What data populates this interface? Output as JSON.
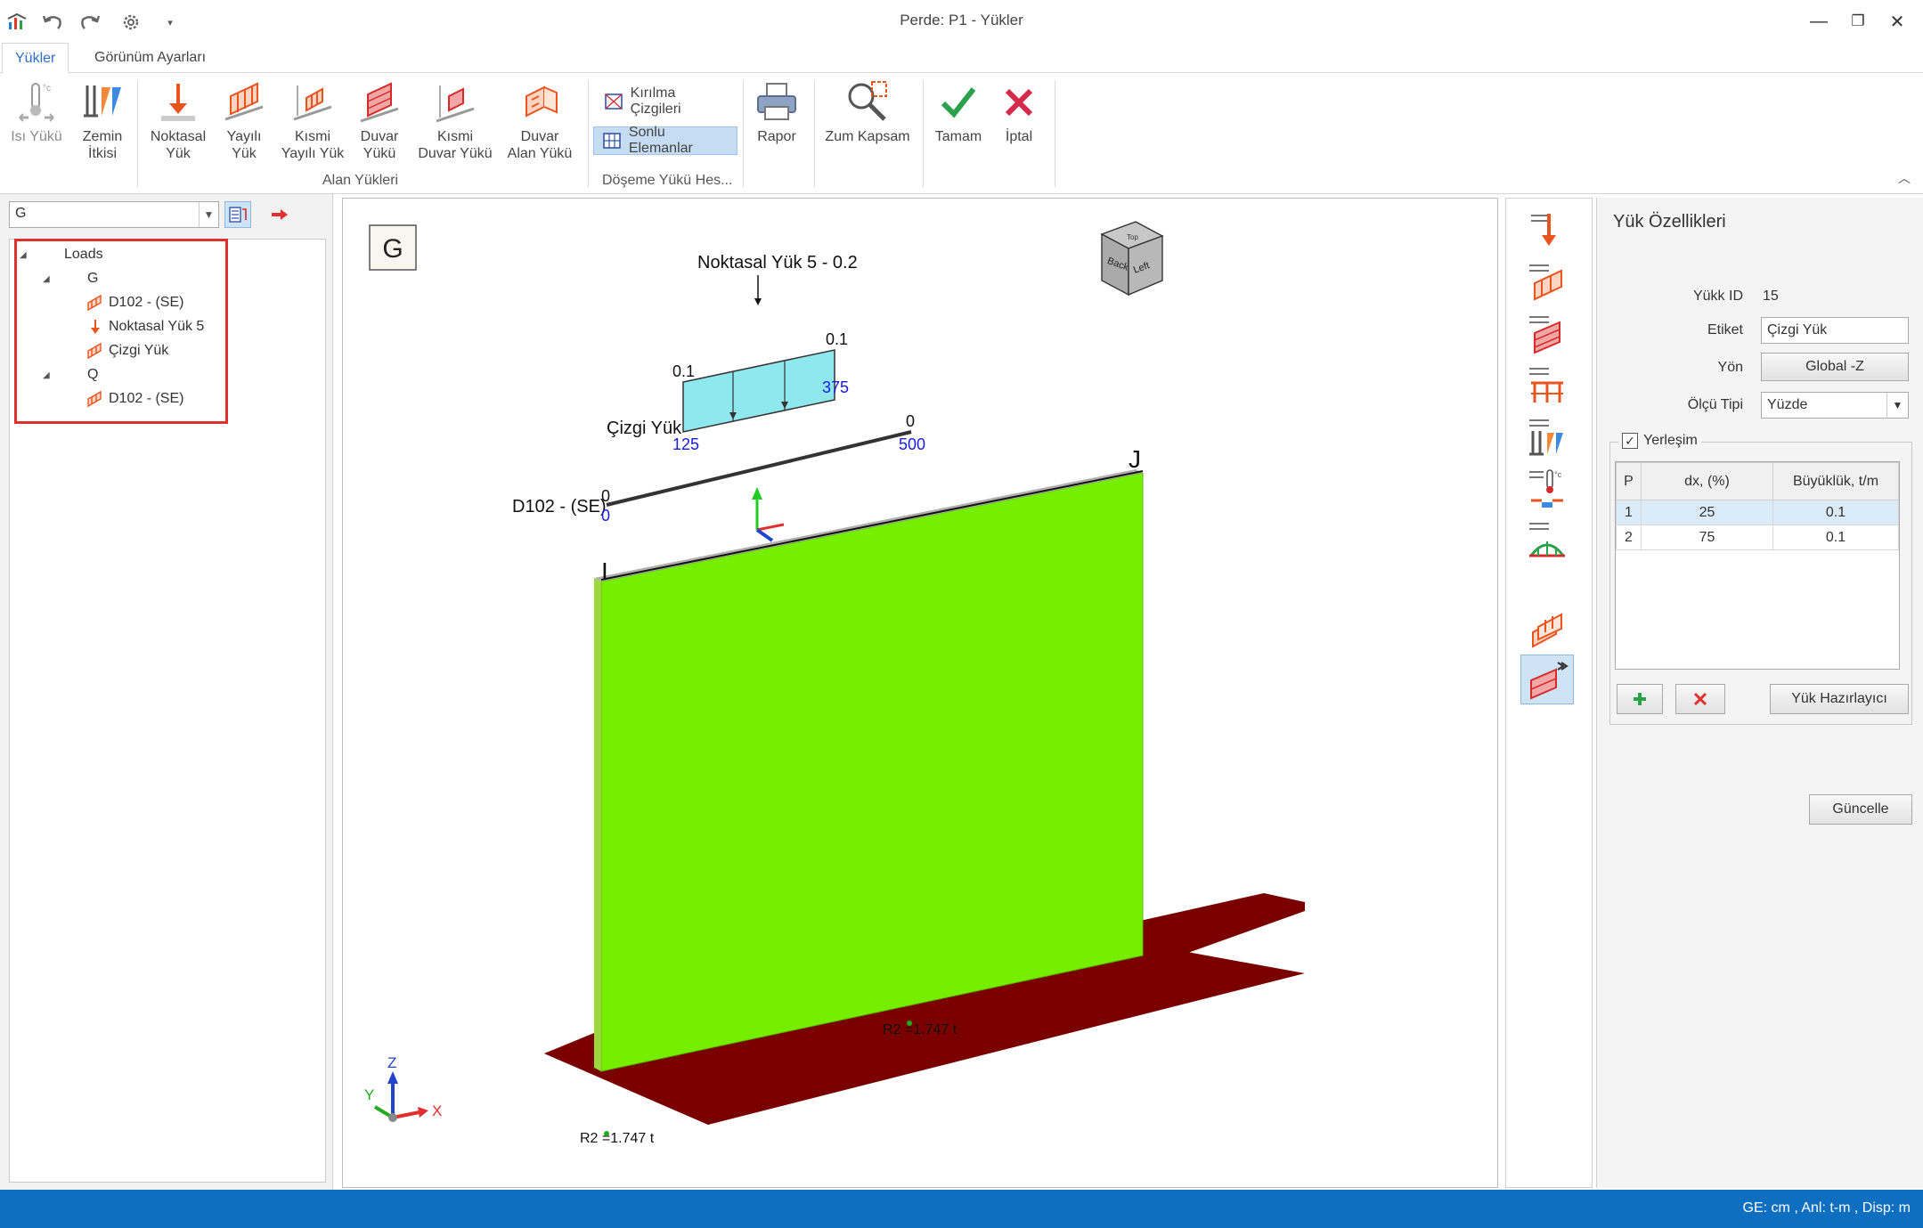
{
  "window": {
    "title": "Perde: P1 - Yükler"
  },
  "tabs": [
    {
      "label": "Yükler",
      "active": true
    },
    {
      "label": "Görünüm Ayarları",
      "active": false
    }
  ],
  "ribbon": {
    "isi_yuku": "Isı Yükü",
    "zemin": [
      "Zemin",
      "İtkisi"
    ],
    "noktasal": [
      "Noktasal",
      "Yük"
    ],
    "yayili": [
      "Yayılı",
      "Yük"
    ],
    "kismi_yayili": [
      "Kısmi",
      "Yayılı Yük"
    ],
    "duvar": [
      "Duvar",
      "Yükü"
    ],
    "kismi_duvar": [
      "Kısmi",
      "Duvar Yükü"
    ],
    "duvar_alan": [
      "Duvar",
      "Alan Yükü"
    ],
    "group_alan": "Alan Yükleri",
    "kirilma": "Kırılma Çizgileri",
    "sonlu": "Sonlu Elemanlar",
    "group_doseme": "Döşeme Yükü Hes...",
    "rapor": "Rapor",
    "zum": "Zum Kapsam",
    "tamam": "Tamam",
    "iptal": "İptal"
  },
  "left": {
    "combo_value": "G",
    "tree": {
      "root": "Loads",
      "g": "G",
      "g_items": [
        "D102 - (SE)",
        "Noktasal Yük 5",
        "Çizgi Yük"
      ],
      "q": "Q",
      "q_items": [
        "D102 - (SE)"
      ]
    }
  },
  "viewport": {
    "case_label": "G",
    "point_load_label": "Noktasal Yük 5 - 0.2",
    "line_load_label": "Çizgi Yük",
    "member_label": "D102 - (SE)",
    "val_left_top": "0.1",
    "val_right_top": "0.1",
    "pos_125": "125",
    "pos_375": "375",
    "pos_500": "500",
    "zero_a": "0",
    "zero_b": "0",
    "zero_c": "0",
    "node_i": "I",
    "node_j": "J",
    "reaction_left": "R2 =1.747 t",
    "reaction_right": "R2 =1.747 t",
    "axis_z": "Z",
    "axis_y": "Y",
    "axis_x": "X",
    "cube_back": "Back",
    "cube_left": "Left",
    "cube_top": "Top"
  },
  "props": {
    "title": "Yük Özellikleri",
    "id_label": "Yükk ID",
    "id_value": "15",
    "etiket_label": "Etiket",
    "etiket_value": "Çizgi Yük",
    "yon_label": "Yön",
    "yon_value": "Global -Z",
    "olcu_label": "Ölçü Tipi",
    "olcu_value": "Yüzde",
    "yerlesim_label": "Yerleşim",
    "grid_headers": [
      "P",
      "dx, (%)",
      "Büyüklük, t/m"
    ],
    "grid_rows": [
      {
        "p": "1",
        "dx": "25",
        "b": "0.1"
      },
      {
        "p": "2",
        "dx": "75",
        "b": "0.1"
      }
    ],
    "hazirlayici": "Yük Hazırlayıcı",
    "guncelle": "Güncelle"
  },
  "status": {
    "text": "GE: cm , Anl: t-m , Disp: m"
  },
  "colors": {
    "wall": "#76ee00",
    "floor": "#7a0000",
    "load_box": "#8ee8ee",
    "accent": "#2b6cc4",
    "status": "#0e6fc0",
    "highlight": "#e03030"
  }
}
